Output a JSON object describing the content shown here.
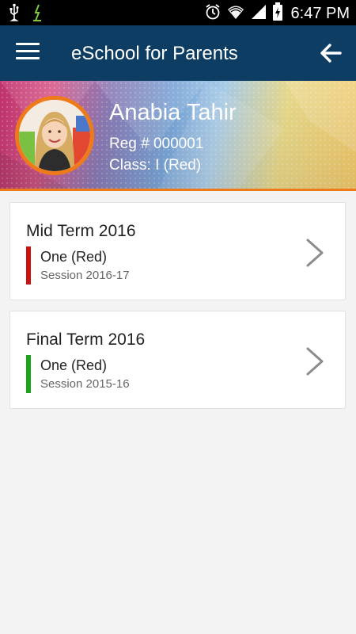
{
  "status_bar": {
    "time": "6:47 PM",
    "icons": [
      "usb-icon",
      "download-icon",
      "alarm-icon",
      "wifi-icon",
      "signal-icon",
      "battery-charging-icon"
    ]
  },
  "app_bar": {
    "title": "eSchool for Parents",
    "menu_icon": "hamburger-menu-icon",
    "back_icon": "arrow-back-icon",
    "color": "#0e3d63"
  },
  "profile": {
    "name": "Anabia Tahir",
    "reg": "Reg # 000001",
    "class": "Class: I (Red)",
    "accent_color": "#ef7a1a"
  },
  "terms": [
    {
      "title": "Mid Term 2016",
      "class": "One (Red)",
      "session": "Session 2016-17",
      "bar_color": "#cc1111"
    },
    {
      "title": "Final Term 2016",
      "class": "One (Red)",
      "session": "Session 2015-16",
      "bar_color": "#1aa51a"
    }
  ]
}
